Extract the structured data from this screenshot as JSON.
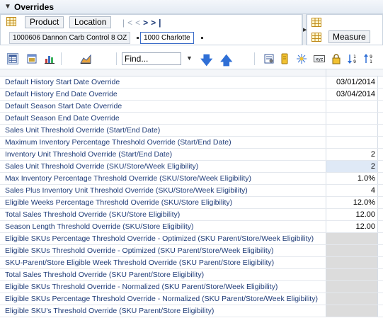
{
  "header": {
    "title": "Overrides"
  },
  "filters": {
    "tabs": [
      "Product",
      "Location"
    ],
    "nav": {
      "first": "|<",
      "prev": "<",
      "next": ">",
      "last": ">|"
    },
    "product_value": "1000606 Dannon Carb Control 8 OZ",
    "location_value": "1000 Charlotte"
  },
  "measures": {
    "tab": "Measure"
  },
  "toolbar": {
    "find_placeholder": "Find...",
    "icons": [
      "grid-view-icon",
      "table-view-icon",
      "bar-chart-icon",
      "area-chart-icon",
      "find-dropdown-icon",
      "arrow-down-icon",
      "arrow-up-icon",
      "properties-icon",
      "highlight-icon",
      "spread-icon",
      "xyz-icon",
      "lock-icon",
      "sort-ascending-icon",
      "sort-descending-icon"
    ]
  },
  "rows": [
    {
      "label": "Default History Start Date Override",
      "value": "03/01/2014",
      "state": "normal"
    },
    {
      "label": "Default History End Date Override",
      "value": "03/04/2014",
      "state": "normal"
    },
    {
      "label": "Default Season Start Date Override",
      "value": "",
      "state": "normal"
    },
    {
      "label": "Default Season End Date Override",
      "value": "",
      "state": "normal"
    },
    {
      "label": "Sales Unit Threshold Override (Start/End Date)",
      "value": "",
      "state": "normal"
    },
    {
      "label": "Maximum Inventory Percentage Threshold Override (Start/End Date)",
      "value": "",
      "state": "normal"
    },
    {
      "label": "Inventory Unit Threshold Override (Start/End Date)",
      "value": "2",
      "state": "normal"
    },
    {
      "label": "Sales Unit Threshold Override (SKU/Store/Week Eligibility)",
      "value": "2",
      "state": "selected"
    },
    {
      "label": "Max Inventory Percentage Threshold Override (SKU/Store/Week Eligibility)",
      "value": "1.0%",
      "state": "normal"
    },
    {
      "label": "Sales Plus Inventory Unit Threshold Override (SKU/Store/Week Eligibility)",
      "value": "4",
      "state": "normal"
    },
    {
      "label": "Eligible Weeks Percentage Threshold Override (SKU/Store Eligibility)",
      "value": "12.0%",
      "state": "normal"
    },
    {
      "label": "Total Sales Threshold Override (SKU/Store Eligibility)",
      "value": "12.00",
      "state": "normal"
    },
    {
      "label": "Season Length Threshold Override (SKU/Store Eligibility)",
      "value": "12.00",
      "state": "normal"
    },
    {
      "label": "Eligible SKUs Percentage Threshold Override - Optimized (SKU Parent/Store/Week Eligibility)",
      "value": "",
      "state": "disabled"
    },
    {
      "label": "Eligible SKUs Threshold Override - Optimized (SKU Parent/Store/Week Eligibility)",
      "value": "",
      "state": "disabled"
    },
    {
      "label": "SKU-Parent/Store Eligible Week Threshold Override (SKU Parent/Store Eligibility)",
      "value": "",
      "state": "disabled"
    },
    {
      "label": "Total Sales Threshold Override (SKU Parent/Store Eligibility)",
      "value": "",
      "state": "disabled"
    },
    {
      "label": "Eligible SKUs Threshold Override - Normalized (SKU Parent/Store/Week Eligibility)",
      "value": "",
      "state": "disabled"
    },
    {
      "label": "Eligible SKUs Percentage Threshold Override - Normalized (SKU Parent/Store/Week Eligibility)",
      "value": "",
      "state": "disabled"
    },
    {
      "label": "Eligible SKU's Threshold Override (SKU Parent/Store Eligibility)",
      "value": "",
      "state": "disabled"
    }
  ]
}
